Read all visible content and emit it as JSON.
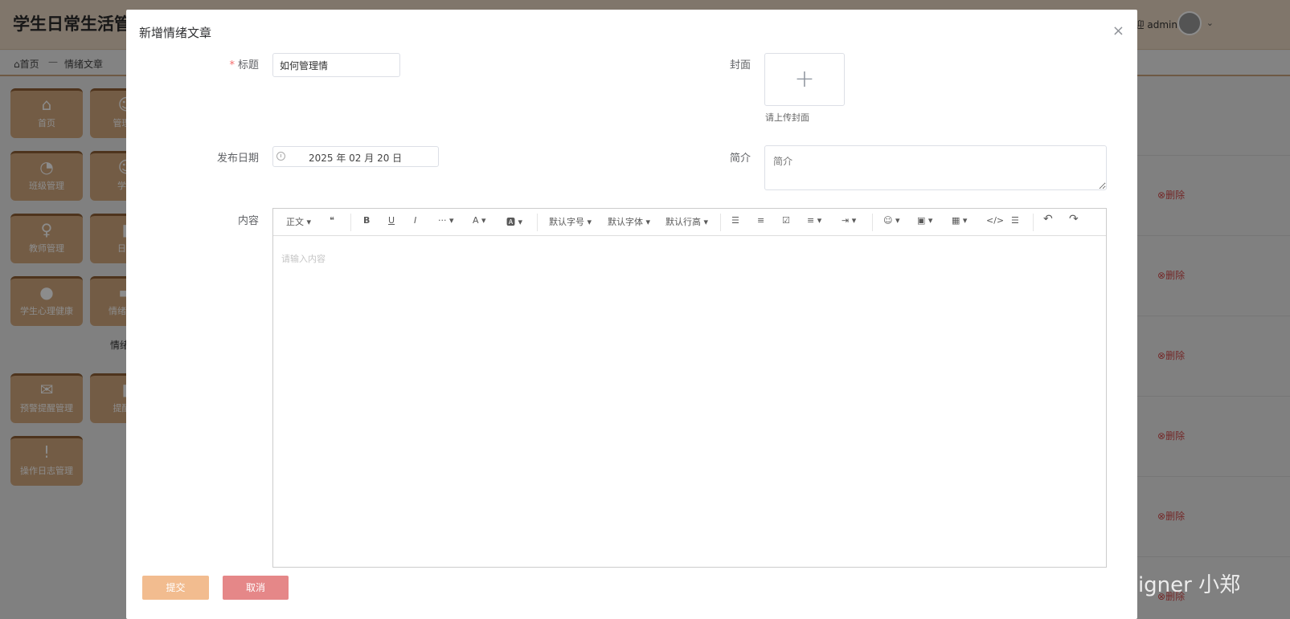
{
  "app": {
    "title": "学生日常生活管",
    "welcome": "欢迎 admin",
    "breadcrumb": {
      "home": "首页",
      "separator": "—",
      "current": "情绪文章"
    }
  },
  "tiles": [
    {
      "label": "首页",
      "icon": "⌂"
    },
    {
      "label": "管理员",
      "icon": "☺"
    },
    {
      "label": "班级管理",
      "icon": "◔"
    },
    {
      "label": "学生",
      "icon": "☺"
    },
    {
      "label": "教师管理",
      "icon": "♀"
    },
    {
      "label": "日志",
      "icon": "▮"
    },
    {
      "label": "学生心理健康",
      "icon": "●"
    },
    {
      "label": "情绪文章",
      "icon": "▬"
    },
    {
      "label": "预警提醒管理",
      "icon": "✉"
    },
    {
      "label": "提醒信",
      "icon": "▮"
    },
    {
      "label": "操作日志管理",
      "icon": "!"
    }
  ],
  "sidebar_sub": "情绪",
  "delete_label": "删除",
  "modal": {
    "title": "新增情绪文章",
    "close_icon": "×",
    "fields": {
      "title_label": "标题",
      "title_value": "如何管理情",
      "cover_label": "封面",
      "cover_hint": "请上传封面",
      "date_label": "发布日期",
      "date_value": "2025 年 02 月 20 日",
      "intro_label": "简介",
      "intro_placeholder": "简介",
      "content_label": "内容",
      "content_placeholder": "请输入内容"
    },
    "toolbar": {
      "paragraph": "正文 ▾",
      "quote": "❝",
      "bold": "B",
      "underline": "U",
      "italic": "I",
      "more": "··· ▾",
      "font_color": "A ▾",
      "bg_color": "🅰 ▾",
      "font_size": "默认字号 ▾",
      "font_family": "默认字体 ▾",
      "line_height": "默认行高 ▾",
      "bullet_list": "☰",
      "numbered_list": "≡",
      "todo": "☑",
      "align": "≡ ▾",
      "indent": "⇥ ▾",
      "emoji": "☺ ▾",
      "image": "▣ ▾",
      "table": "▦ ▾",
      "code": "</>",
      "divider": "☰",
      "undo": "↶",
      "redo": "↷"
    },
    "buttons": {
      "submit": "提交",
      "cancel": "取消"
    }
  },
  "watermark": "CSDN @Designer 小郑",
  "colors": {
    "accent": "#f2bc8f",
    "danger": "#e58788",
    "topbar": "#ead7c3"
  }
}
